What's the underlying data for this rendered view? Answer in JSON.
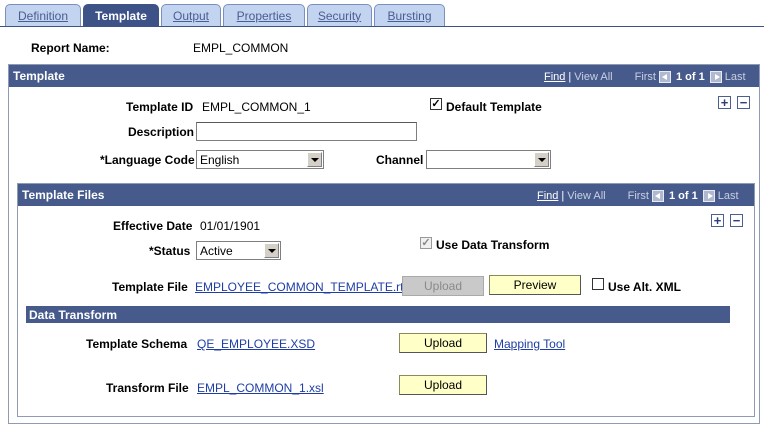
{
  "tabs": [
    {
      "label": "Definition",
      "active": false
    },
    {
      "label": "Template",
      "active": true
    },
    {
      "label": "Output",
      "active": false
    },
    {
      "label": "Properties",
      "active": false
    },
    {
      "label": "Security",
      "active": false
    },
    {
      "label": "Bursting",
      "active": false
    }
  ],
  "report": {
    "label": "Report Name:",
    "value": "EMPL_COMMON"
  },
  "template_group": {
    "title": "Template",
    "nav": {
      "find": "Find",
      "view_all": "View All",
      "first": "First",
      "count": "1 of 1",
      "last": "Last"
    },
    "template_id": {
      "label": "Template ID",
      "value": "EMPL_COMMON_1"
    },
    "default_template": {
      "label": "Default Template",
      "checked": true
    },
    "description": {
      "label": "Description",
      "value": ""
    },
    "language_code": {
      "label": "*Language Code",
      "value": "English"
    },
    "channel": {
      "label": "Channel",
      "value": ""
    }
  },
  "files_group": {
    "title": "Template Files",
    "nav": {
      "find": "Find",
      "view_all": "View All",
      "first": "First",
      "count": "1 of 1",
      "last": "Last"
    },
    "effective_date": {
      "label": "Effective Date",
      "value": "01/01/1901"
    },
    "status": {
      "label": "*Status",
      "value": "Active"
    },
    "use_data_transform": {
      "label": "Use Data Transform",
      "checked": true
    },
    "template_file": {
      "label": "Template File",
      "value": "EMPLOYEE_COMMON_TEMPLATE.rtf"
    },
    "upload_label": "Upload",
    "preview_label": "Preview",
    "use_alt_xml": {
      "label": "Use Alt. XML",
      "checked": false
    }
  },
  "data_transform": {
    "title": "Data Transform",
    "template_schema": {
      "label": "Template Schema",
      "value": "QE_EMPLOYEE.XSD"
    },
    "schema_upload_label": "Upload",
    "mapping_tool": "Mapping Tool",
    "transform_file": {
      "label": "Transform File",
      "value": "EMPL_COMMON_1.xsl"
    },
    "transform_upload_label": "Upload"
  },
  "icons": {
    "add": "+",
    "remove": "−",
    "check": "✓"
  }
}
